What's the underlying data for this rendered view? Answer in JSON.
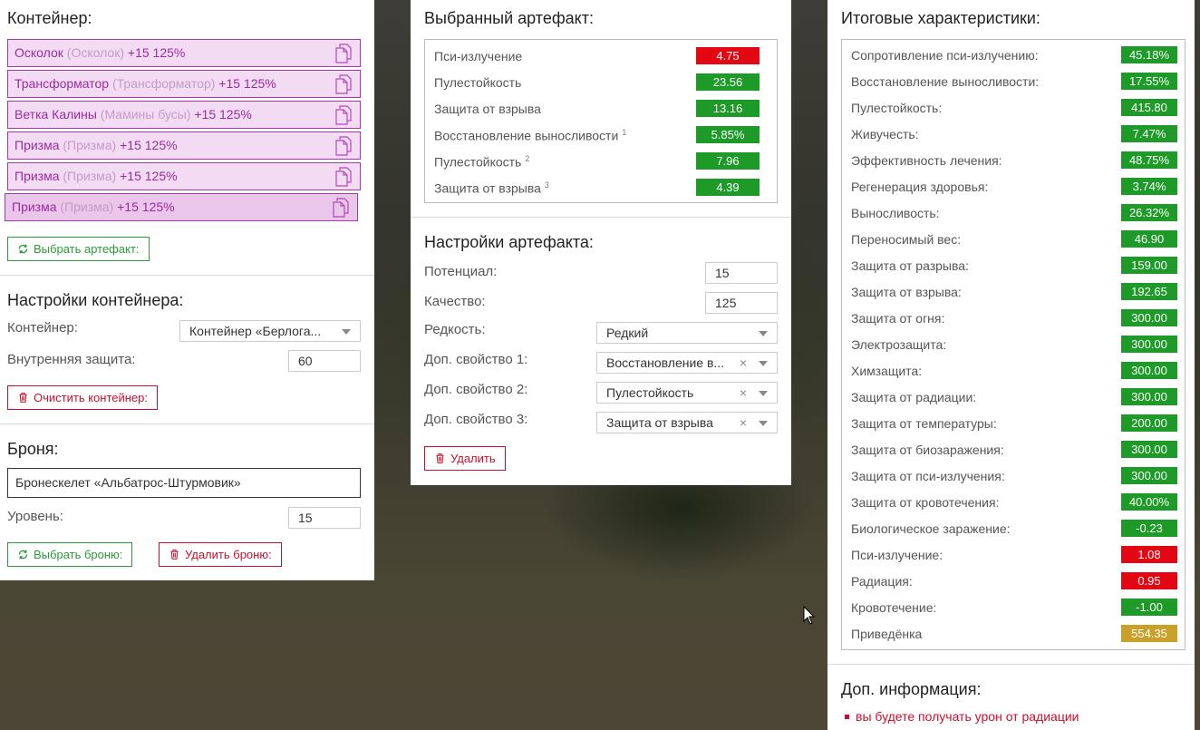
{
  "container": {
    "title": "Контейнер:",
    "items": [
      {
        "name": "Осколок",
        "orig": "(Осколок)",
        "level": "+15 125%"
      },
      {
        "name": "Трансформатор",
        "orig": "(Трансформатор)",
        "level": "+15 125%"
      },
      {
        "name": "Ветка Калины",
        "orig": "(Мамины бусы)",
        "level": "+15 125%"
      },
      {
        "name": "Призма",
        "orig": "(Призма)",
        "level": "+15 125%"
      },
      {
        "name": "Призма",
        "orig": "(Призма)",
        "level": "+15 125%"
      },
      {
        "name": "Призма",
        "orig": "(Призма)",
        "level": "+15 125%"
      }
    ],
    "select_button": "Выбрать артефакт:"
  },
  "container_settings": {
    "title": "Настройки контейнера:",
    "container_label": "Контейнер:",
    "container_value": "Контейнер «Берлога...",
    "protection_label": "Внутренняя защита:",
    "protection_value": "60",
    "clear_button": "Очистить контейнер:"
  },
  "armor": {
    "title": "Броня:",
    "value": "Бронескелет «Альбатрос-Штурмовик»",
    "level_label": "Уровень:",
    "level_value": "15",
    "select_button": "Выбрать броню:",
    "delete_button": "Удалить броню:"
  },
  "selected_artifact": {
    "title": "Выбранный артефакт:",
    "stats": [
      {
        "name": "Пси-излучение",
        "sup": "",
        "value": "4.75",
        "color": "red"
      },
      {
        "name": "Пулестойкость",
        "sup": "",
        "value": "23.56",
        "color": "green"
      },
      {
        "name": "Защита от взрыва",
        "sup": "",
        "value": "13.16",
        "color": "green"
      },
      {
        "name": "Восстановление выносливости",
        "sup": "1",
        "value": "5.85%",
        "color": "green"
      },
      {
        "name": "Пулестойкость",
        "sup": "2",
        "value": "7.96",
        "color": "green"
      },
      {
        "name": "Защита от взрыва",
        "sup": "3",
        "value": "4.39",
        "color": "green"
      }
    ]
  },
  "artifact_settings": {
    "title": "Настройки артефакта:",
    "potential_label": "Потенциал:",
    "potential_value": "15",
    "quality_label": "Качество:",
    "quality_value": "125",
    "rarity_label": "Редкость:",
    "rarity_value": "Редкий",
    "extra1_label": "Доп. свойство 1:",
    "extra1_value": "Восстановление в...",
    "extra2_label": "Доп. свойство 2:",
    "extra2_value": "Пулестойкость",
    "extra3_label": "Доп. свойство 3:",
    "extra3_value": "Защита от взрыва",
    "clear_symbol": "×",
    "delete_button": "Удалить"
  },
  "totals": {
    "title": "Итоговые характеристики:",
    "stats": [
      {
        "name": "Сопротивление пси-излучению:",
        "value": "45.18%",
        "color": "green"
      },
      {
        "name": "Восстановление выносливости:",
        "value": "17.55%",
        "color": "green"
      },
      {
        "name": "Пулестойкость:",
        "value": "415.80",
        "color": "green"
      },
      {
        "name": "Живучесть:",
        "value": "7.47%",
        "color": "green"
      },
      {
        "name": "Эффективность лечения:",
        "value": "48.75%",
        "color": "green"
      },
      {
        "name": "Регенерация здоровья:",
        "value": "3.74%",
        "color": "green"
      },
      {
        "name": "Выносливость:",
        "value": "26.32%",
        "color": "green"
      },
      {
        "name": "Переносимый вес:",
        "value": "46.90",
        "color": "green"
      },
      {
        "name": "Защита от разрыва:",
        "value": "159.00",
        "color": "green"
      },
      {
        "name": "Защита от взрыва:",
        "value": "192.65",
        "color": "green"
      },
      {
        "name": "Защита от огня:",
        "value": "300.00",
        "color": "green"
      },
      {
        "name": "Электрозащита:",
        "value": "300.00",
        "color": "green"
      },
      {
        "name": "Химзащита:",
        "value": "300.00",
        "color": "green"
      },
      {
        "name": "Защита от радиации:",
        "value": "300.00",
        "color": "green"
      },
      {
        "name": "Защита от температуры:",
        "value": "200.00",
        "color": "green"
      },
      {
        "name": "Защита от биозаражения:",
        "value": "300.00",
        "color": "green"
      },
      {
        "name": "Защита от пси-излучения:",
        "value": "300.00",
        "color": "green"
      },
      {
        "name": "Защита от кровотечения:",
        "value": "40.00%",
        "color": "green"
      },
      {
        "name": "Биологическое заражение:",
        "value": "-0.23",
        "color": "green"
      },
      {
        "name": "Пси-излучение:",
        "value": "1.08",
        "color": "red"
      },
      {
        "name": "Радиация:",
        "value": "0.95",
        "color": "red"
      },
      {
        "name": "Кровотечение:",
        "value": "-1.00",
        "color": "green"
      },
      {
        "name": "Приведёнка",
        "value": "554.35",
        "color": "yellow"
      }
    ]
  },
  "extra_info": {
    "title": "Доп. информация:",
    "items": [
      "вы будете получать урон от радиации"
    ]
  },
  "colors": {
    "green": "#1e9a28",
    "red": "#e30613",
    "yellow": "#c8a02a",
    "artifact_border": "#a03aa8"
  },
  "icons": {
    "artifact_item": "document-copy-icon",
    "select": "refresh-icon",
    "delete": "trash-icon"
  }
}
